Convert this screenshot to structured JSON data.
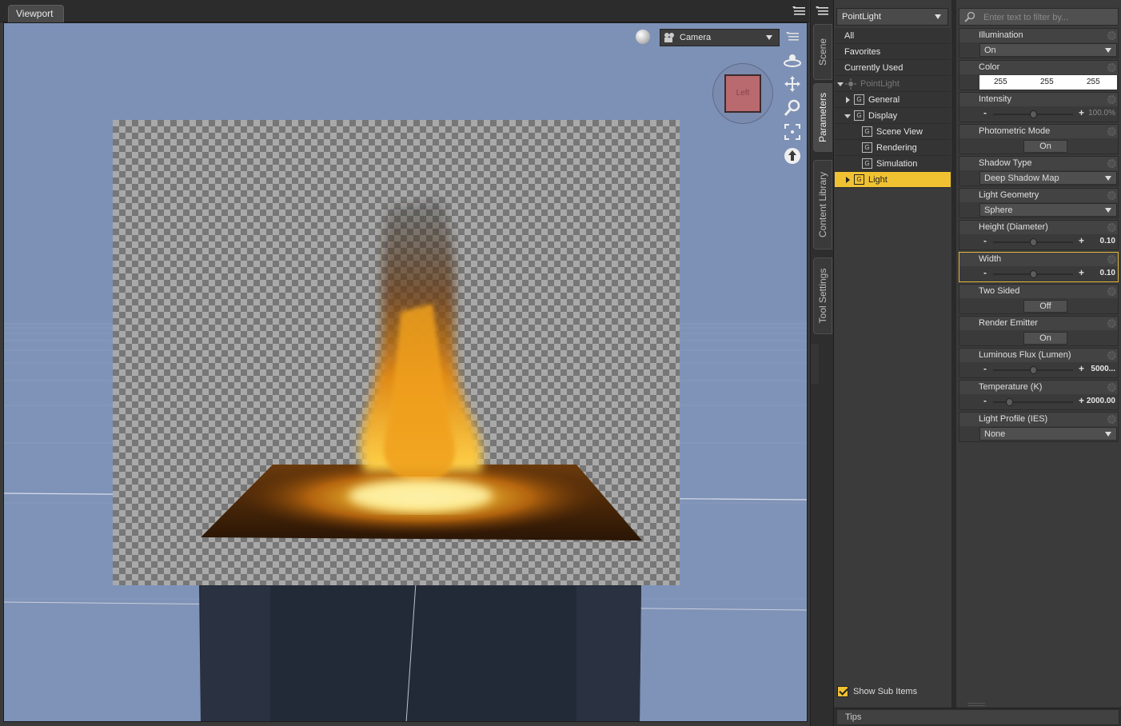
{
  "viewport": {
    "tab_label": "Viewport",
    "camera_label": "Camera",
    "cube_face_label": "Left"
  },
  "side_tabs": [
    "Scene",
    "Parameters",
    "Content Library",
    "Tool Settings"
  ],
  "nodes": {
    "selected_node": "PointLight",
    "groups": [
      {
        "label": "All"
      },
      {
        "label": "Favorites"
      },
      {
        "label": "Currently Used"
      },
      {
        "label": "PointLight"
      },
      {
        "label": "General"
      },
      {
        "label": "Display"
      },
      {
        "label": "Scene View"
      },
      {
        "label": "Rendering"
      },
      {
        "label": "Simulation"
      },
      {
        "label": "Light"
      }
    ],
    "show_sub_items_label": "Show Sub Items",
    "show_sub_items_checked": true
  },
  "properties": {
    "filter_placeholder": "Enter text to filter by...",
    "items": [
      {
        "name": "Illumination",
        "kind": "dropdown",
        "value": "On"
      },
      {
        "name": "Color",
        "kind": "color",
        "r": "255",
        "g": "255",
        "b": "255"
      },
      {
        "name": "Intensity",
        "kind": "slider",
        "value": "100.0%",
        "level": 0.5
      },
      {
        "name": "Photometric Mode",
        "kind": "toggle",
        "value": "On"
      },
      {
        "name": "Shadow Type",
        "kind": "dropdown",
        "value": "Deep Shadow Map"
      },
      {
        "name": "Light Geometry",
        "kind": "dropdown",
        "value": "Sphere"
      },
      {
        "name": "Height (Diameter)",
        "kind": "slider",
        "value": "0.10",
        "level": 0.5
      },
      {
        "name": "Width",
        "kind": "slider",
        "value": "0.10",
        "level": 0.5
      },
      {
        "name": "Two Sided",
        "kind": "toggle",
        "value": "Off"
      },
      {
        "name": "Render Emitter",
        "kind": "toggle",
        "value": "On"
      },
      {
        "name": "Luminous Flux (Lumen)",
        "kind": "slider",
        "value": "5000...",
        "level": 0.5
      },
      {
        "name": "Temperature (K)",
        "kind": "slider",
        "value": "2000.00",
        "level": 0.2
      },
      {
        "name": "Light Profile (IES)",
        "kind": "dropdown",
        "value": "None"
      }
    ]
  },
  "tips_label": "Tips",
  "colors": {
    "accent": "#f0c232",
    "viewport_bg": "#7d91b6",
    "panel_bg": "#3b3b3b"
  }
}
